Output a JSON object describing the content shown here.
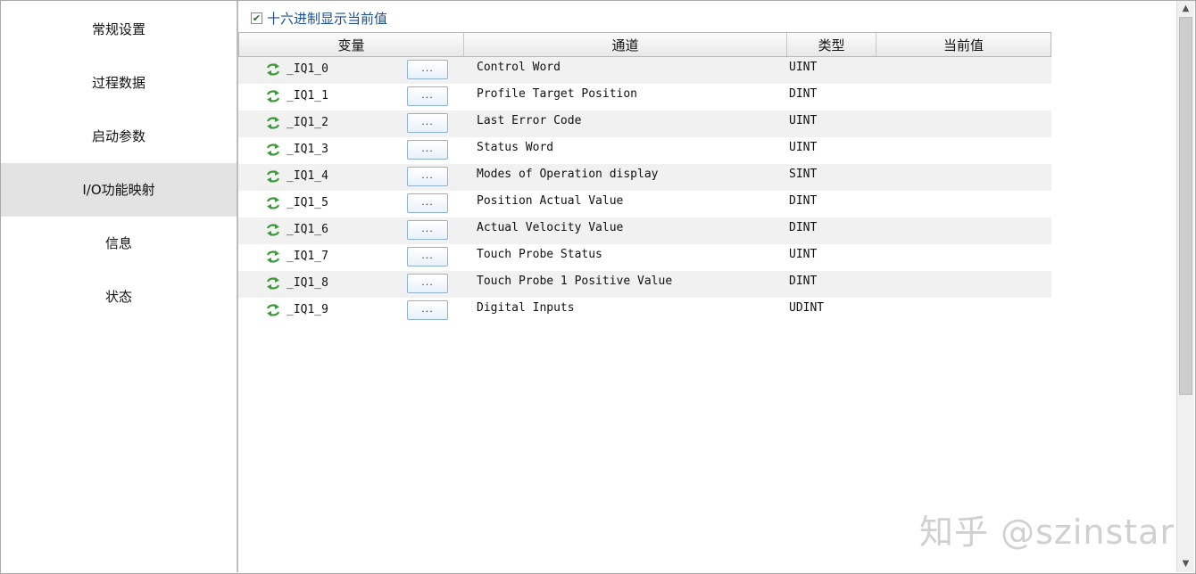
{
  "sidebar": {
    "items": [
      {
        "label": "常规设置",
        "active": false
      },
      {
        "label": "过程数据",
        "active": false
      },
      {
        "label": "启动参数",
        "active": false
      },
      {
        "label": "I/O功能映射",
        "active": true
      },
      {
        "label": "信息",
        "active": false
      },
      {
        "label": "状态",
        "active": false
      }
    ]
  },
  "hex_option": {
    "label": "十六进制显示当前值",
    "checked": true
  },
  "table": {
    "headers": {
      "variable": "变量",
      "channel": "通道",
      "type": "类型",
      "current_value": "当前值"
    },
    "browse_label": "...",
    "rows": [
      {
        "variable": "_IQ1_0",
        "channel": "Control Word",
        "type": "UINT",
        "value": ""
      },
      {
        "variable": "_IQ1_1",
        "channel": "Profile Target Position",
        "type": "DINT",
        "value": ""
      },
      {
        "variable": "_IQ1_2",
        "channel": "Last Error Code",
        "type": "UINT",
        "value": ""
      },
      {
        "variable": "_IQ1_3",
        "channel": "Status Word",
        "type": "UINT",
        "value": ""
      },
      {
        "variable": "_IQ1_4",
        "channel": "Modes of Operation display",
        "type": "SINT",
        "value": ""
      },
      {
        "variable": "_IQ1_5",
        "channel": "Position Actual Value",
        "type": "DINT",
        "value": ""
      },
      {
        "variable": "_IQ1_6",
        "channel": "Actual Velocity Value",
        "type": "DINT",
        "value": ""
      },
      {
        "variable": "_IQ1_7",
        "channel": "Touch Probe Status",
        "type": "UINT",
        "value": ""
      },
      {
        "variable": "_IQ1_8",
        "channel": "Touch Probe 1 Positive Value",
        "type": "DINT",
        "value": ""
      },
      {
        "variable": "_IQ1_9",
        "channel": "Digital Inputs",
        "type": "UDINT",
        "value": ""
      }
    ]
  },
  "icons": {
    "row_icon": "sync-arrows-icon",
    "check_icon": "checkmark-icon"
  },
  "colors": {
    "active_item_bg": "#e3e3e3",
    "link_text": "#1c4f8f",
    "icon_green": "#3a9a3a"
  },
  "watermark": "知乎 @szinstar"
}
